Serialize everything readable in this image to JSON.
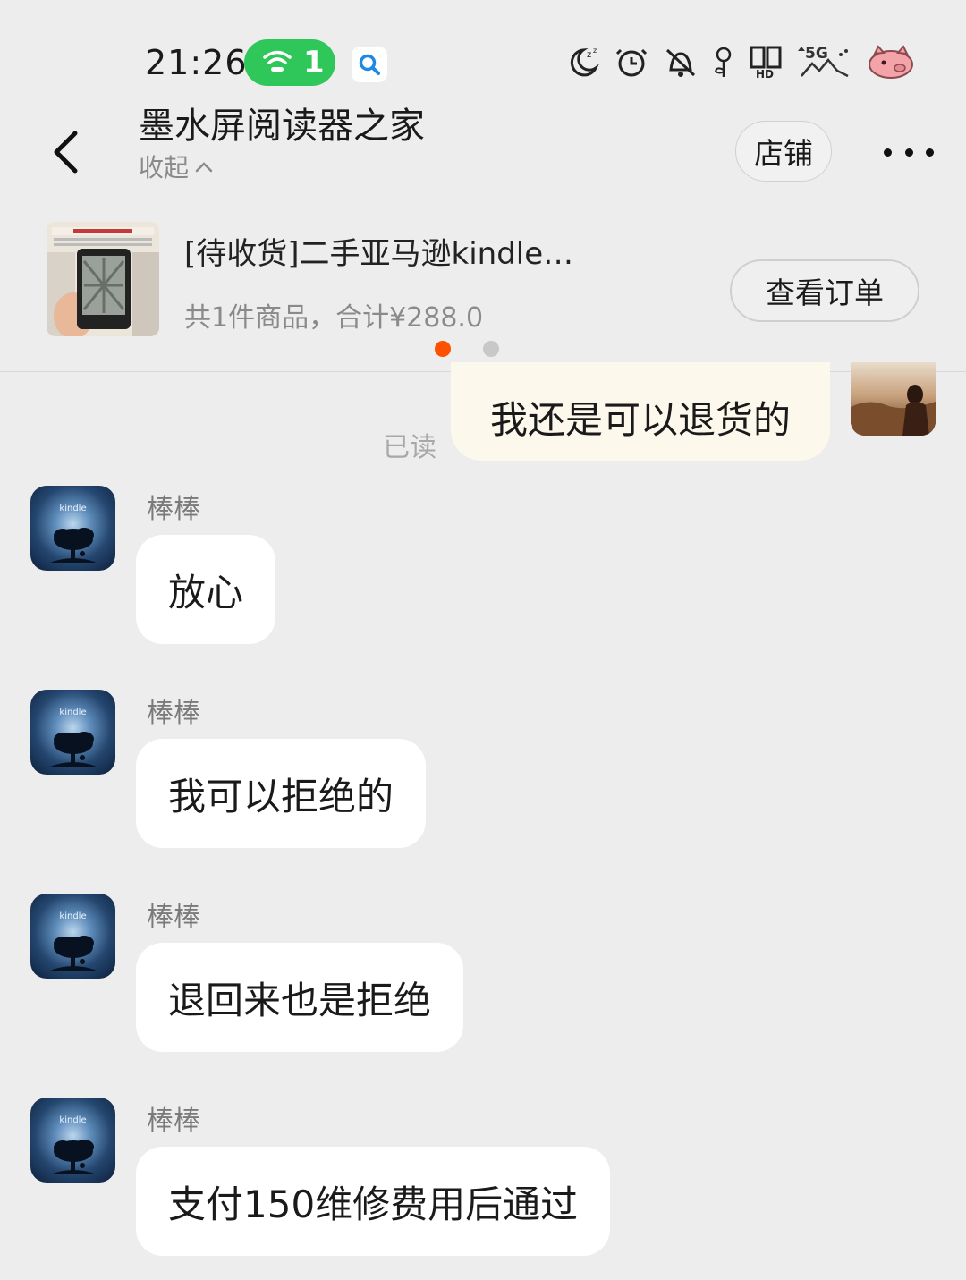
{
  "status_bar": {
    "time": "21:26",
    "wifi_badge_count": "1",
    "network_label": "5G",
    "hd_label": "HD",
    "icons": [
      "moon-sleep-icon",
      "alarm-icon",
      "mute-icon",
      "flower-icon",
      "hd-signal-icon",
      "5g-signal-icon",
      "battery-pig-icon"
    ]
  },
  "header": {
    "title": "墨水屏阅读器之家",
    "collapse_label": "收起",
    "store_button": "店铺"
  },
  "order": {
    "title": "[待收货]二手亚马逊kindle…",
    "summary": "共1件商品，合计¥288.0",
    "view_order_button": "查看订单",
    "carousel_total": 2,
    "carousel_active": 1
  },
  "chat": {
    "my_message": {
      "text": "我还是可以退货的",
      "read_status": "已读"
    },
    "incoming": [
      {
        "sender": "棒棒",
        "text": "放心"
      },
      {
        "sender": "棒棒",
        "text": "我可以拒绝的"
      },
      {
        "sender": "棒棒",
        "text": "退回来也是拒绝"
      },
      {
        "sender": "棒棒",
        "text": "支付150维修费用后通过"
      }
    ],
    "avatar_logo_text": "kindle"
  },
  "colors": {
    "background": "#ededed",
    "wifi_pill": "#2fc65a",
    "active_dot": "#ff5000",
    "inactive_dot": "#c8c8c8",
    "my_bubble": "#fdf8ec",
    "incoming_bubble": "#ffffff"
  }
}
